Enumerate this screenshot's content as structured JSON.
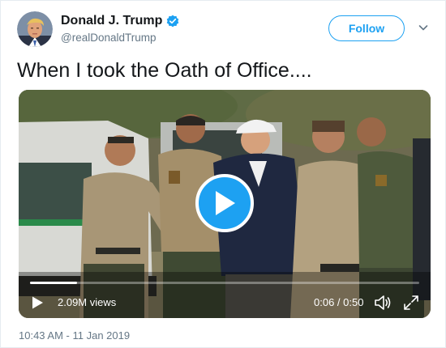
{
  "author": {
    "display_name": "Donald J. Trump",
    "handle": "@realDonaldTrump",
    "verified": true,
    "avatar_icon": "user-avatar-photo"
  },
  "follow_button": {
    "label": "Follow"
  },
  "menu": {
    "icon": "chevron-down-icon"
  },
  "tweet": {
    "text": "When I took the Oath of Office...."
  },
  "video": {
    "views": "2.09M views",
    "time": "0:06 / 0:50",
    "progress": 0.12,
    "play_icon": "play-icon",
    "volume_icon": "volume-icon",
    "fullscreen_icon": "fullscreen-icon"
  },
  "timestamp": "10:43 AM - 11 Jan 2019",
  "colors": {
    "accent": "#1da1f2",
    "text": "#14171a",
    "muted": "#657786"
  }
}
